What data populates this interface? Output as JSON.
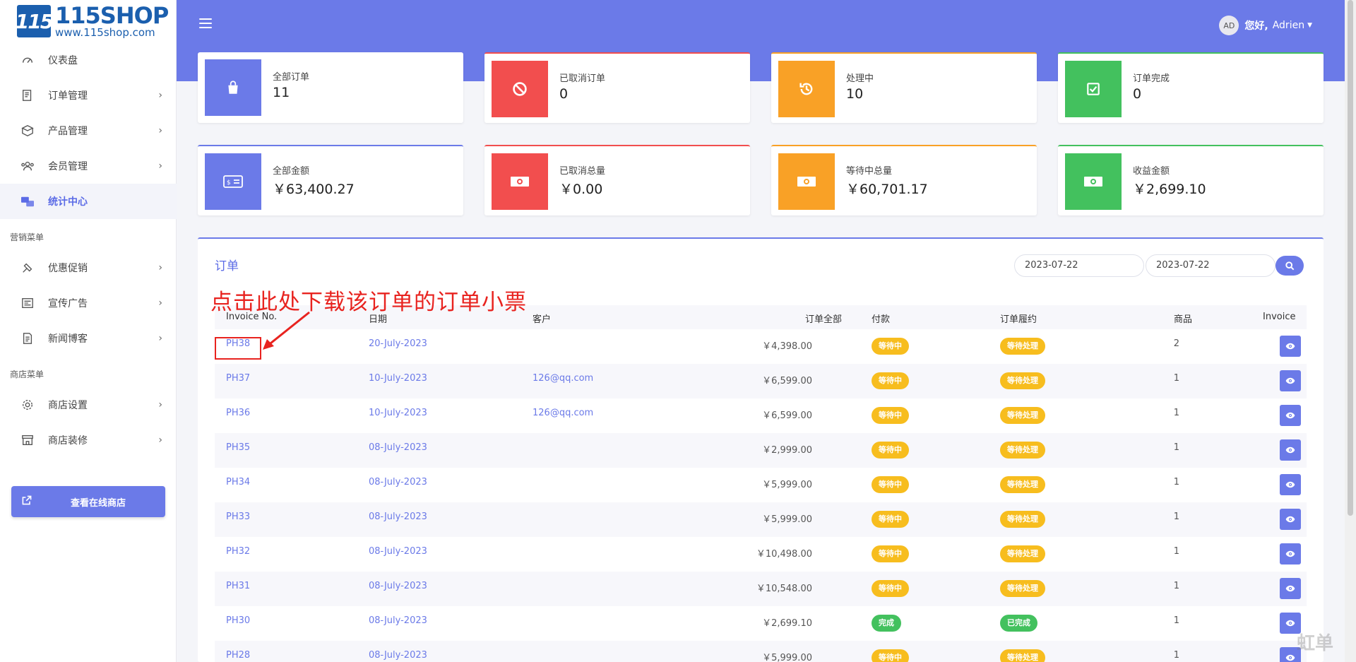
{
  "brand": {
    "logo_mark": "115",
    "name": "115SHOP",
    "url": "www.115shop.com"
  },
  "sidebar": {
    "items": [
      {
        "label": "仪表盘",
        "icon": "dashboard-icon",
        "chevron": false
      },
      {
        "label": "订单管理",
        "icon": "orders-icon",
        "chevron": true
      },
      {
        "label": "产品管理",
        "icon": "products-icon",
        "chevron": true
      },
      {
        "label": "会员管理",
        "icon": "members-icon",
        "chevron": true
      },
      {
        "label": "统计中心",
        "icon": "stats-icon",
        "chevron": false,
        "active": true
      }
    ],
    "section_marketing": "营销菜单",
    "marketing_items": [
      {
        "label": "优惠促销",
        "icon": "promo-icon"
      },
      {
        "label": "宣传广告",
        "icon": "ads-icon"
      },
      {
        "label": "新闻博客",
        "icon": "news-icon"
      }
    ],
    "section_shop": "商店菜单",
    "shop_items": [
      {
        "label": "商店设置",
        "icon": "gear-icon"
      },
      {
        "label": "商店装修",
        "icon": "store-icon"
      }
    ],
    "view_shop_button": "查看在线商店"
  },
  "header": {
    "avatar": "AD",
    "greeting": "您好,",
    "username": "Adrien"
  },
  "stats_row1": [
    {
      "title": "全部订单",
      "value": "11",
      "color": "#6b7ae8"
    },
    {
      "title": "已取消订单",
      "value": "0",
      "color": "#f24e4e"
    },
    {
      "title": "处理中",
      "value": "10",
      "color": "#f9a126"
    },
    {
      "title": "订单完成",
      "value": "0",
      "color": "#43c15e"
    }
  ],
  "stats_row2": [
    {
      "title": "全部金额",
      "value": "￥63,400.27",
      "color": "#6b7ae8"
    },
    {
      "title": "已取消总量",
      "value": "￥0.00",
      "color": "#f24e4e"
    },
    {
      "title": "等待中总量",
      "value": "￥60,701.17",
      "color": "#f9a126"
    },
    {
      "title": "收益金额",
      "value": "￥2,699.10",
      "color": "#43c15e"
    }
  ],
  "orders": {
    "title": "订单",
    "date_from": "2023-07-22",
    "date_to": "2023-07-22",
    "annotation": "点击此处下载该订单的订单小票",
    "columns": [
      "Invoice No.",
      "日期",
      "客户",
      "订单全部",
      "付款",
      "订单履约",
      "商品",
      "Invoice"
    ],
    "rows": [
      {
        "invoice": "PH38",
        "date": "20-July-2023",
        "customer": "",
        "total": "￥4,398.00",
        "payment": "等待中",
        "fulfillment": "等待处理",
        "qty": "2",
        "status": "wait"
      },
      {
        "invoice": "PH37",
        "date": "10-July-2023",
        "customer": "126@qq.com",
        "total": "￥6,599.00",
        "payment": "等待中",
        "fulfillment": "等待处理",
        "qty": "1",
        "status": "wait"
      },
      {
        "invoice": "PH36",
        "date": "10-July-2023",
        "customer": "126@qq.com",
        "total": "￥6,599.00",
        "payment": "等待中",
        "fulfillment": "等待处理",
        "qty": "1",
        "status": "wait"
      },
      {
        "invoice": "PH35",
        "date": "08-July-2023",
        "customer": "",
        "total": "￥2,999.00",
        "payment": "等待中",
        "fulfillment": "等待处理",
        "qty": "1",
        "status": "wait"
      },
      {
        "invoice": "PH34",
        "date": "08-July-2023",
        "customer": "",
        "total": "￥5,999.00",
        "payment": "等待中",
        "fulfillment": "等待处理",
        "qty": "1",
        "status": "wait"
      },
      {
        "invoice": "PH33",
        "date": "08-July-2023",
        "customer": "",
        "total": "￥5,999.00",
        "payment": "等待中",
        "fulfillment": "等待处理",
        "qty": "1",
        "status": "wait"
      },
      {
        "invoice": "PH32",
        "date": "08-July-2023",
        "customer": "",
        "total": "￥10,498.00",
        "payment": "等待中",
        "fulfillment": "等待处理",
        "qty": "1",
        "status": "wait"
      },
      {
        "invoice": "PH31",
        "date": "08-July-2023",
        "customer": "",
        "total": "￥10,548.00",
        "payment": "等待中",
        "fulfillment": "等待处理",
        "qty": "1",
        "status": "wait"
      },
      {
        "invoice": "PH30",
        "date": "08-July-2023",
        "customer": "",
        "total": "￥2,699.10",
        "payment": "完成",
        "fulfillment": "已完成",
        "qty": "1",
        "status": "done"
      },
      {
        "invoice": "PH28",
        "date": "08-July-2023",
        "customer": "",
        "total": "￥5,999.00",
        "payment": "等待中",
        "fulfillment": "等待处理",
        "qty": "1",
        "status": "wait"
      }
    ]
  },
  "watermark": "虹单"
}
